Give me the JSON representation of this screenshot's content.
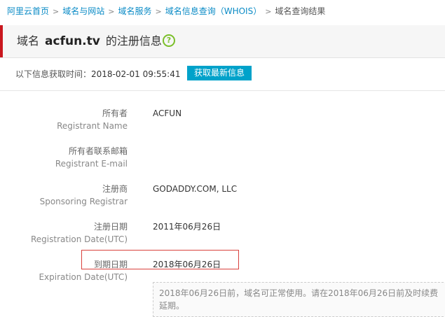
{
  "breadcrumb": {
    "items": [
      "阿里云首页",
      "域名与网站",
      "域名服务",
      "域名信息查询（WHOIS）"
    ],
    "current": "域名查询结果"
  },
  "header": {
    "prefix": "域名",
    "domain": "acfun.tv",
    "suffix": "的注册信息",
    "help_glyph": "?"
  },
  "fetch": {
    "label": "以下信息获取时间：",
    "time": "2018-02-01 09:55:41",
    "button_label": "获取最新信息"
  },
  "fields": [
    {
      "label_cn": "所有者",
      "label_en": "Registrant Name",
      "value": "ACFUN"
    },
    {
      "label_cn": "所有者联系邮箱",
      "label_en": "Registrant E-mail",
      "value": ""
    },
    {
      "label_cn": "注册商",
      "label_en": "Sponsoring Registrar",
      "value": "GODADDY.COM, LLC"
    },
    {
      "label_cn": "注册日期",
      "label_en": "Registration Date(UTC)",
      "value": "2011年06月26日"
    },
    {
      "label_cn": "到期日期",
      "label_en": "Expiration Date(UTC)",
      "value": "2018年06月26日"
    }
  ],
  "expiry_note": "2018年06月26日前，域名可正常使用。请在2018年06月26日前及时续费延期。",
  "colors": {
    "link": "#0a8bc6",
    "accent_bar": "#c9171e",
    "button": "#00a2ca",
    "highlight": "#d9413d",
    "help_icon": "#7bbf2a"
  }
}
